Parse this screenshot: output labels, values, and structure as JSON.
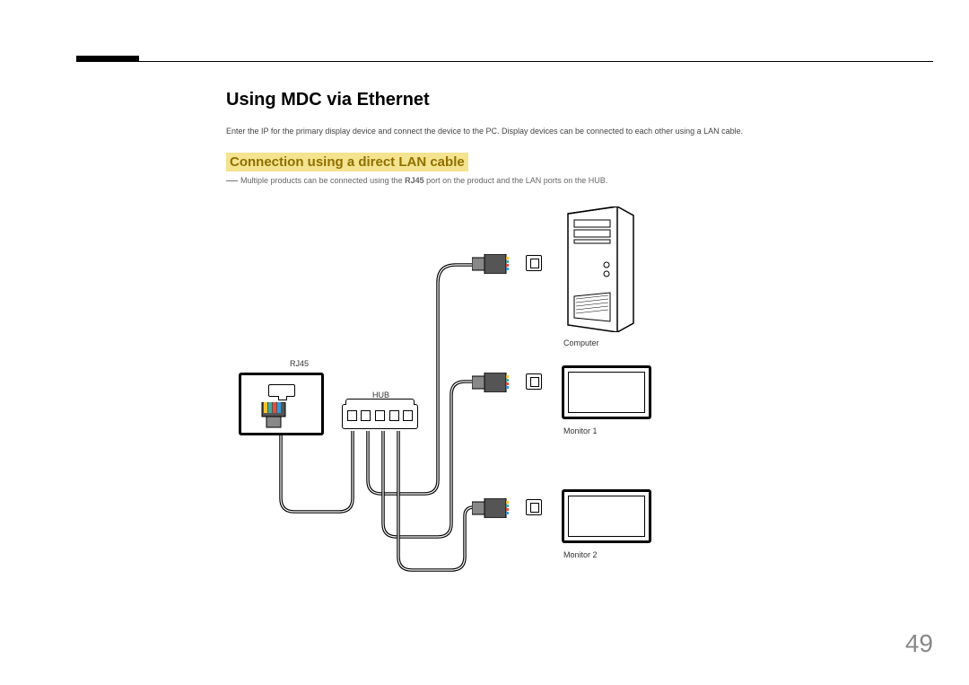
{
  "page_number": "49",
  "heading": "Using MDC via Ethernet",
  "intro": "Enter the IP for the primary display device and connect the device to the PC. Display devices can be connected to each other using a LAN cable.",
  "sub_heading": "Connection using a direct LAN cable",
  "note_prefix": "―",
  "note_part1": "Multiple products can be connected using the ",
  "note_bold": "RJ45",
  "note_part2": " port on the product and the LAN ports on the HUB.",
  "labels": {
    "rj45": "RJ45",
    "hub": "HUB",
    "computer": "Computer",
    "monitor1": "Monitor 1",
    "monitor2": "Monitor 2"
  }
}
